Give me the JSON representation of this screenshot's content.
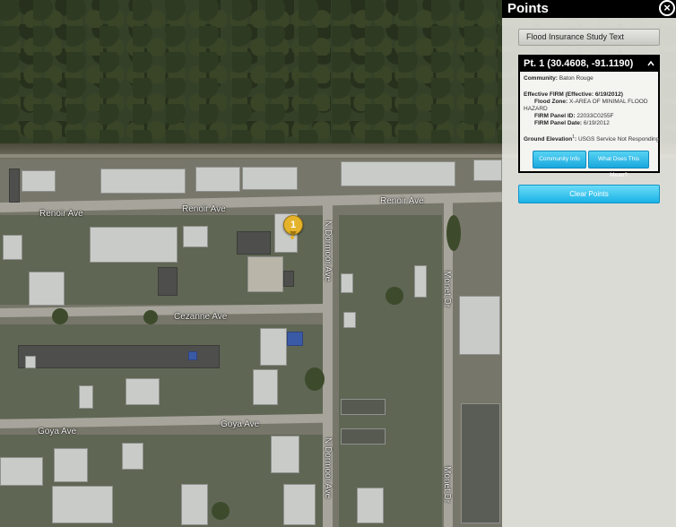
{
  "map": {
    "streets": {
      "renoir_west": "Renoir Ave",
      "renoir_mid": "Renoir Ave",
      "renoir_east": "Renoir Ave",
      "cezanne": "Cezanne Ave",
      "goya": "Goya Ave",
      "dormoor_north": "N Dormoor Ave",
      "dormoor_south": "N Dormoor Ave",
      "monet_north": "Monet Dr",
      "monet_south": "Monet Dr"
    },
    "marker_label": "1"
  },
  "panel": {
    "title": "Points",
    "close_icon": "close-icon",
    "flood_study_button": "Flood Insurance Study Text",
    "point": {
      "header": "Pt. 1 (30.4608, -91.1190)",
      "community_label": "Community:",
      "community_value": "Baton Rouge",
      "effective_firm": "Effective FIRM (Effective:  6/19/2012)",
      "flood_zone_label": "Flood Zone:",
      "flood_zone_value": "X-AREA OF MINIMAL FLOOD",
      "flood_zone_value2": "HAZARD",
      "panel_id_label": "FIRM Panel ID:",
      "panel_id_value": "22033C0255F",
      "panel_date_label": "FIRM Panel Date:",
      "panel_date_value": "6/19/2012",
      "ground_elev_label": "Ground Elevation",
      "ground_elev_sup": "1",
      "ground_elev_value": "USGS Service Not Responding",
      "community_info_button": "Community Info",
      "what_does_this_mean_button": "What Does This Mean?"
    },
    "clear_points_button": "Clear Points"
  },
  "colors": {
    "accent": "#1bb2e6",
    "marker": "#e5b32b",
    "header_bg": "#000000"
  }
}
